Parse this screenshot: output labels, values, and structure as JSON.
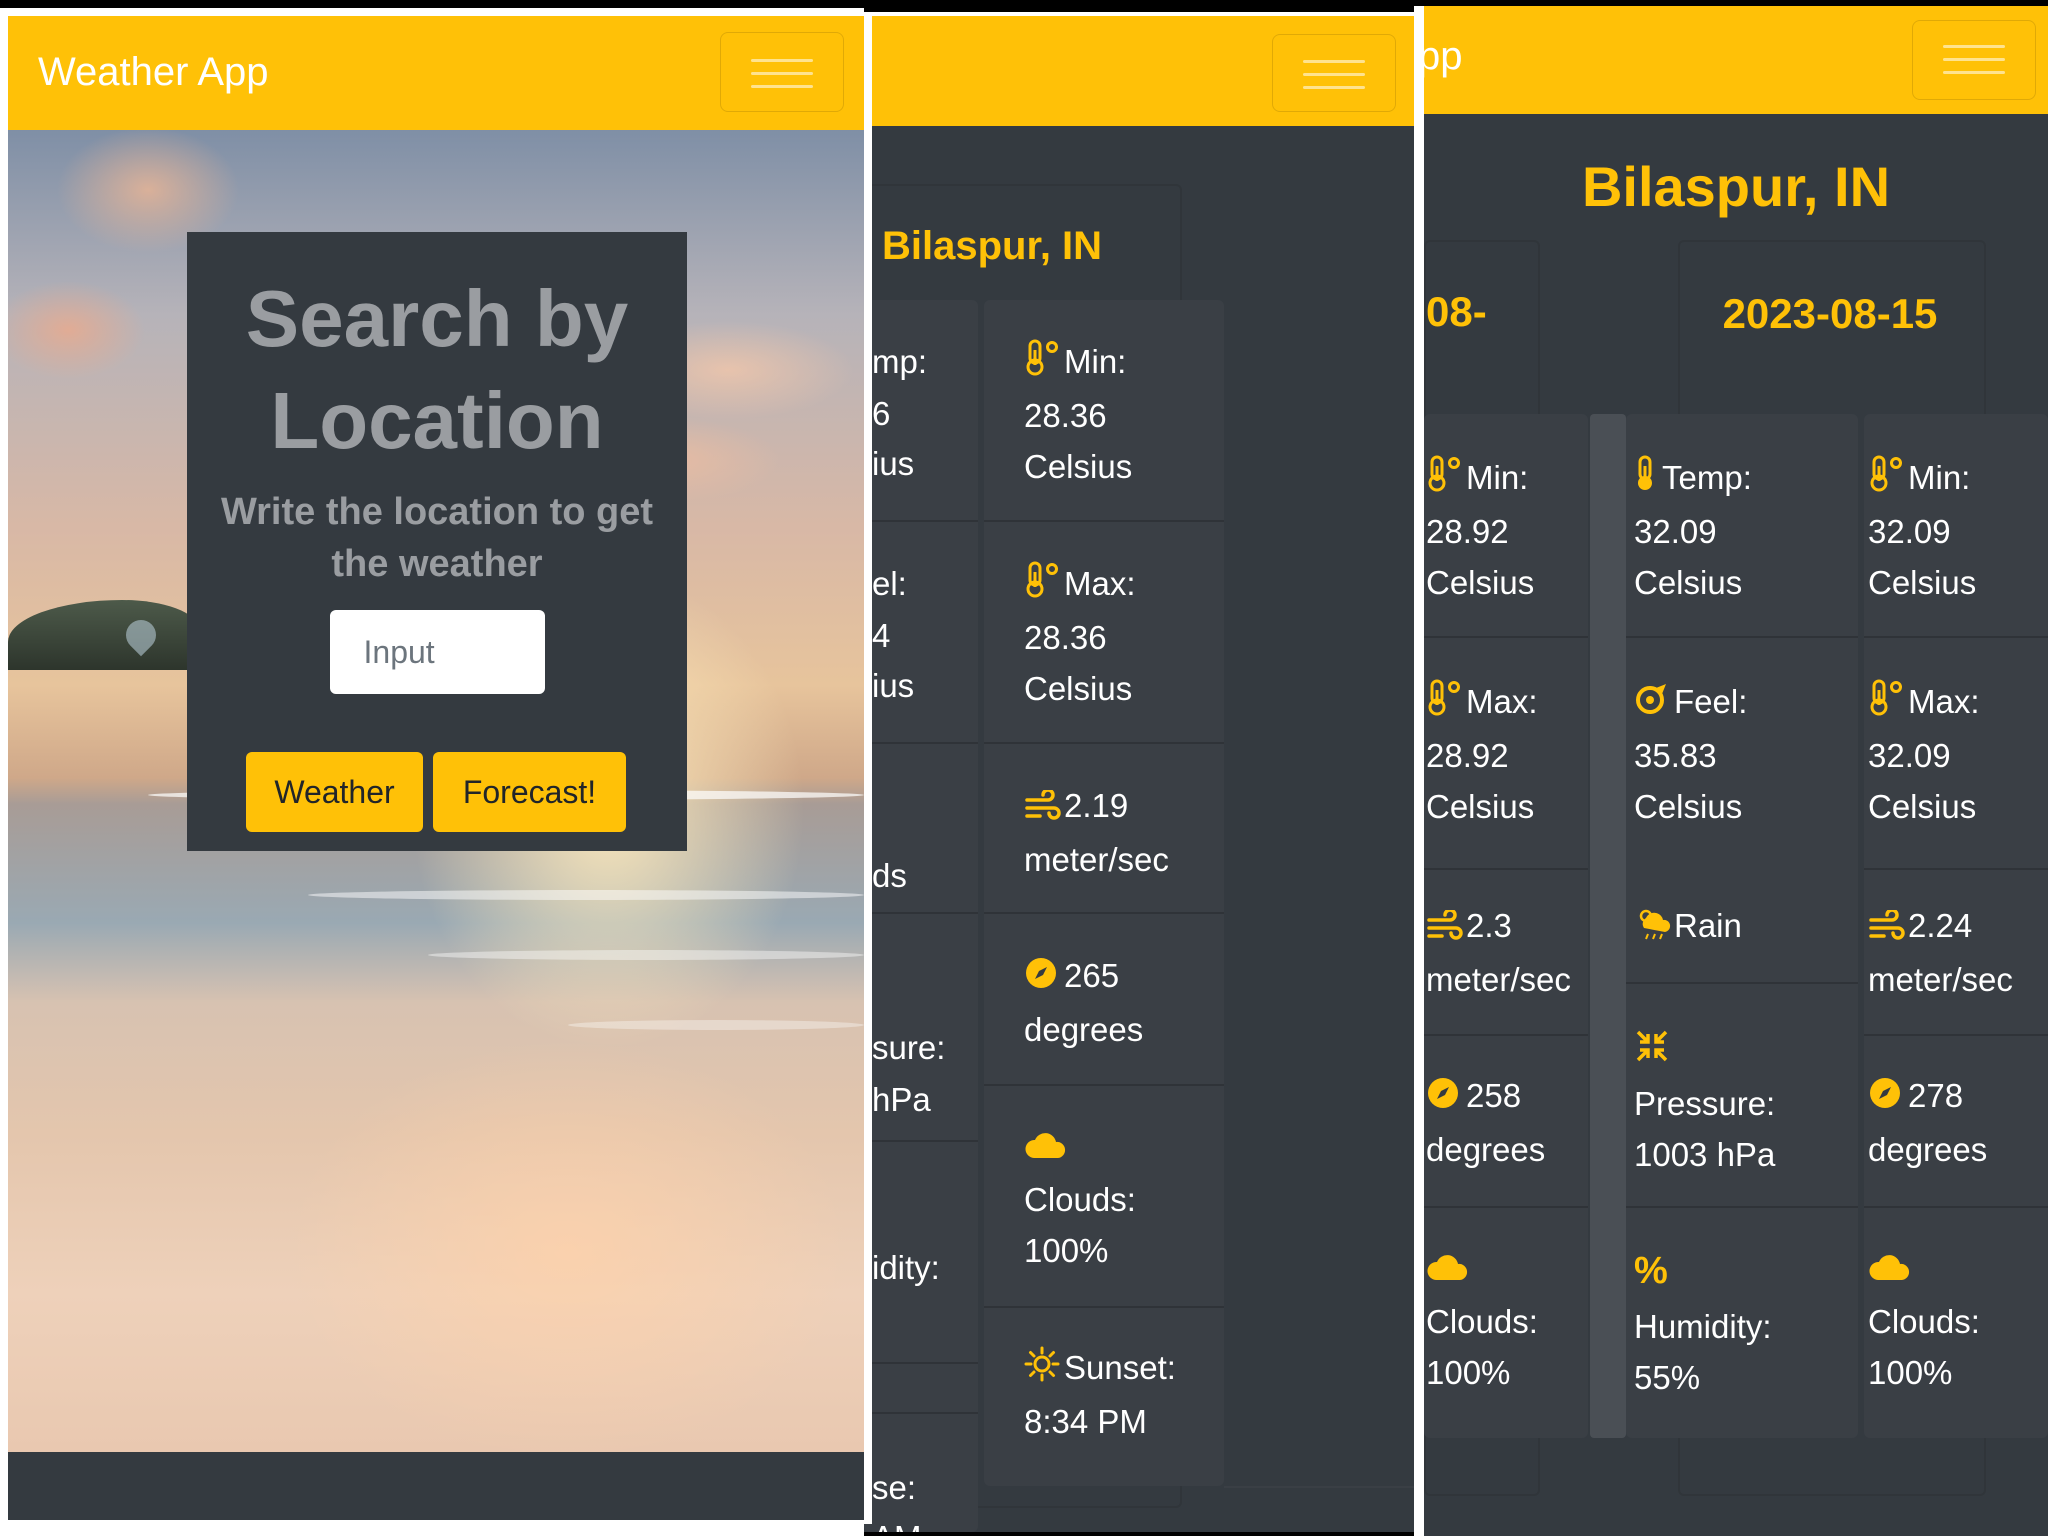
{
  "brand": "Weather App",
  "brand_partial": "pp",
  "search": {
    "title": "Search by Location",
    "subtitle": "Write the location to get the weather",
    "placeholder": "Input",
    "weather_button": "Weather",
    "forecast_button": "Forecast!"
  },
  "panel2": {
    "city": "Bilaspur, IN",
    "left_col": [
      "mp:",
      "6",
      "ius",
      "el:",
      "4",
      "ius",
      "ds",
      "sure:",
      "hPa",
      "idity:",
      "se:",
      "AM"
    ],
    "right_col": [
      {
        "icon": "thermometer-icon",
        "label": "Min:",
        "value": "28.36",
        "unit": "Celsius"
      },
      {
        "icon": "thermometer-icon",
        "label": "Max:",
        "value": "28.36",
        "unit": "Celsius"
      },
      {
        "icon": "wind-icon",
        "label": "2.19",
        "value": "meter/sec",
        "unit": ""
      },
      {
        "icon": "compass-icon",
        "label": "265",
        "value": "degrees",
        "unit": ""
      },
      {
        "icon": "cloud-icon",
        "label": "",
        "value": "Clouds:",
        "unit": "100%"
      },
      {
        "icon": "sun-icon",
        "label": "Sunset:",
        "value": "8:34 PM",
        "unit": ""
      }
    ]
  },
  "panel3": {
    "city": "Bilaspur, IN",
    "date_partial": "08-",
    "date": "2023-08-15",
    "col_a": [
      {
        "icon": "thermometer-icon",
        "label": "Min:",
        "value": "28.92",
        "unit": "Celsius"
      },
      {
        "icon": "thermometer-icon",
        "label": "Max:",
        "value": "28.92",
        "unit": "Celsius"
      },
      {
        "icon": "wind-icon",
        "label": "2.3",
        "value": "meter/sec",
        "unit": ""
      },
      {
        "icon": "compass-icon",
        "label": "258",
        "value": "degrees",
        "unit": ""
      },
      {
        "icon": "cloud-icon",
        "label": "",
        "value": "Clouds:",
        "unit": "100%"
      }
    ],
    "col_b": [
      {
        "icon": "thermometer-icon",
        "label": "Temp:",
        "value": "32.09",
        "unit": "Celsius"
      },
      {
        "icon": "feel-icon",
        "label": "Feel:",
        "value": "35.83",
        "unit": "Celsius"
      },
      {
        "icon": "rain-icon",
        "label": "Rain",
        "value": "",
        "unit": ""
      },
      {
        "icon": "pressure-icon",
        "label": "",
        "value": "Pressure:",
        "unit": "1003 hPa"
      },
      {
        "icon": "percent-icon",
        "label": "",
        "value": "Humidity:",
        "unit": "55%"
      }
    ],
    "col_c": [
      {
        "icon": "thermometer-icon",
        "label": "Min:",
        "value": "32.09",
        "unit": "Celsius"
      },
      {
        "icon": "thermometer-icon",
        "label": "Max:",
        "value": "32.09",
        "unit": "Celsius"
      },
      {
        "icon": "wind-icon",
        "label": "2.24",
        "value": "meter/sec",
        "unit": ""
      },
      {
        "icon": "compass-icon",
        "label": "278",
        "value": "degrees",
        "unit": ""
      },
      {
        "icon": "cloud-icon",
        "label": "",
        "value": "Clouds:",
        "unit": "100%"
      }
    ]
  },
  "colors": {
    "accent": "#ffc107",
    "dark": "#343a40",
    "card": "#3a3f45"
  }
}
